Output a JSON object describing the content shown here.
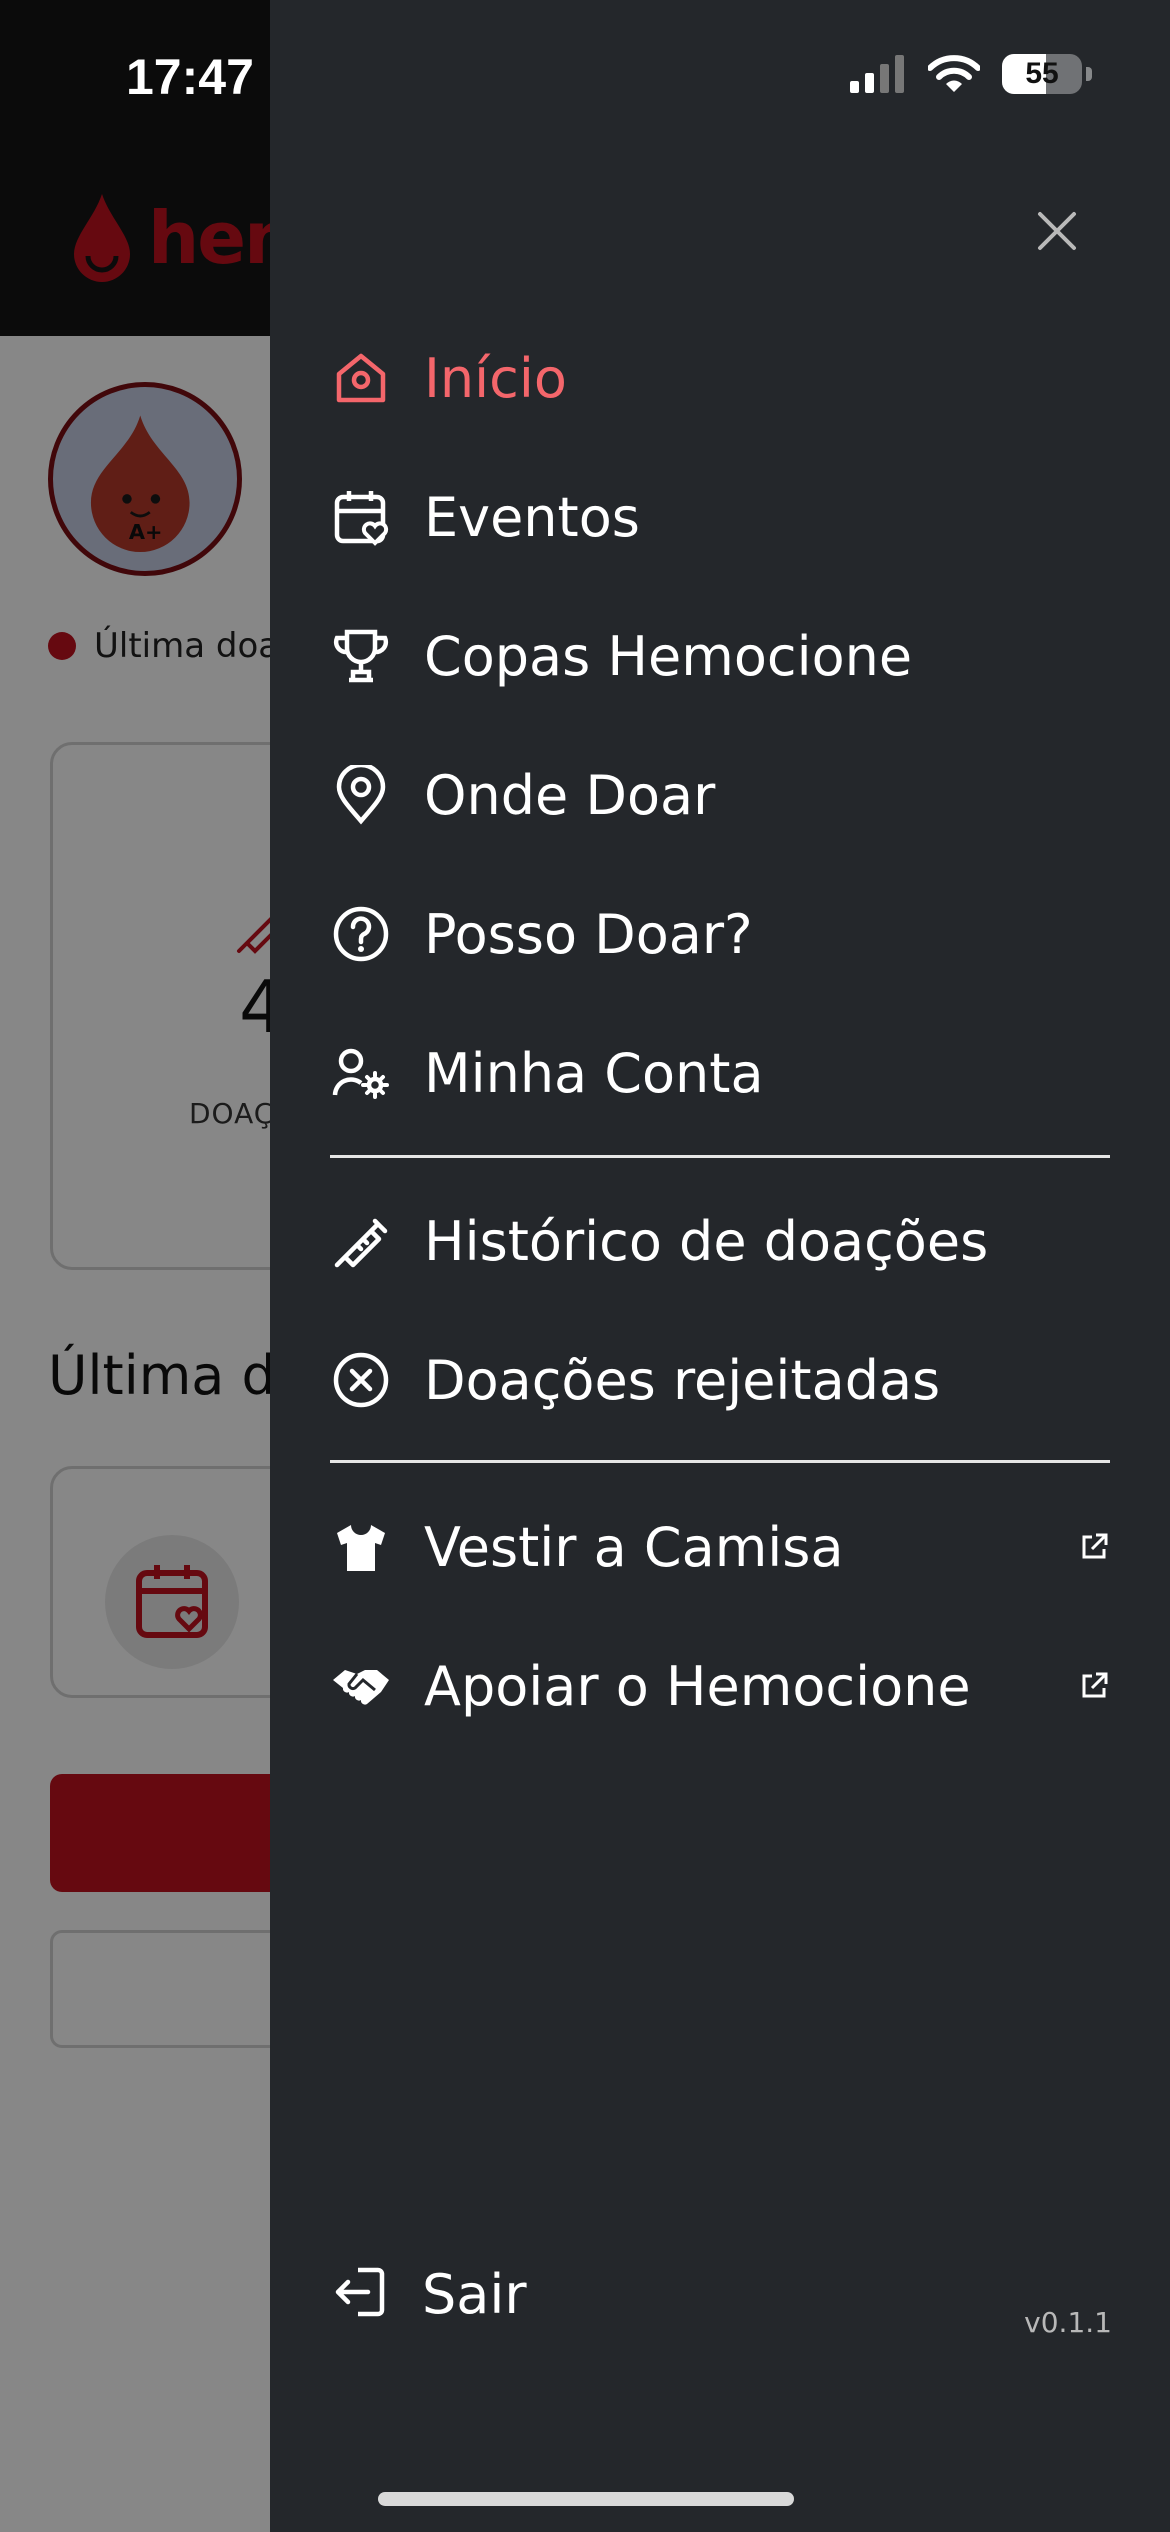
{
  "status_bar": {
    "time": "17:47",
    "battery_percent": 55,
    "battery_label": "55",
    "signal_bars": 2,
    "wifi": true
  },
  "background": {
    "app_name_fragment": "hem",
    "last_donation_text": "Última doação",
    "donations_count_fragment": "4",
    "donations_label_fragment": "DOAÇ",
    "section_title_fragment": "Última do",
    "brand_color": "#c1121f"
  },
  "drawer": {
    "close_icon": "close-icon",
    "items": [
      {
        "label": "Início",
        "icon": "home-icon",
        "active": true
      },
      {
        "label": "Eventos",
        "icon": "calendar-heart-icon"
      },
      {
        "label": "Copas Hemocione",
        "icon": "trophy-icon"
      },
      {
        "label": "Onde Doar",
        "icon": "map-pin-icon"
      },
      {
        "label": "Posso Doar?",
        "icon": "question-circle-icon"
      },
      {
        "label": "Minha Conta",
        "icon": "user-gear-icon"
      },
      {
        "label": "Histórico de doações",
        "icon": "syringe-icon"
      },
      {
        "label": "Doações rejeitadas",
        "icon": "x-circle-icon"
      },
      {
        "label": "Vestir a Camisa",
        "icon": "tshirt-icon",
        "external": true
      },
      {
        "label": "Apoiar o Hemocione",
        "icon": "handshake-icon",
        "external": true
      }
    ],
    "logout_label": "Sair",
    "version": "v0.1.1",
    "active_color": "#f4666b",
    "background_color": "#24272b"
  }
}
